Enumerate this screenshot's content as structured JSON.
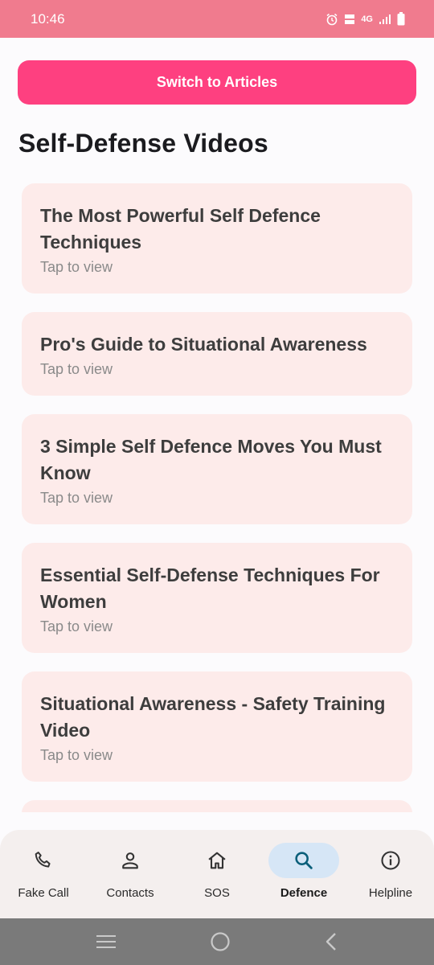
{
  "status_bar": {
    "time": "10:46",
    "network_label": "4G"
  },
  "toolbar": {
    "switch_label": "Switch to Articles"
  },
  "page": {
    "title": "Self-Defense Videos"
  },
  "videos": [
    {
      "title": "The Most Powerful Self Defence Techniques",
      "subtitle": "Tap to view"
    },
    {
      "title": "Pro's Guide to Situational Awareness",
      "subtitle": "Tap to view"
    },
    {
      "title": "3 Simple Self Defence Moves You Must Know",
      "subtitle": "Tap to view"
    },
    {
      "title": "Essential Self-Defense Techniques For Women",
      "subtitle": "Tap to view"
    },
    {
      "title": "Situational Awareness - Safety Training Video",
      "subtitle": "Tap to view"
    }
  ],
  "bottom_nav": {
    "items": [
      {
        "label": "Fake Call",
        "icon": "phone-icon"
      },
      {
        "label": "Contacts",
        "icon": "person-icon"
      },
      {
        "label": "SOS",
        "icon": "home-icon"
      },
      {
        "label": "Defence",
        "icon": "search-icon",
        "active": true
      },
      {
        "label": "Helpline",
        "icon": "info-icon"
      }
    ]
  },
  "colors": {
    "status_bar": "#f07b8e",
    "accent_button": "#fe4080",
    "card_bg": "#fdebea",
    "nav_active_pill": "#d6e6f6"
  }
}
